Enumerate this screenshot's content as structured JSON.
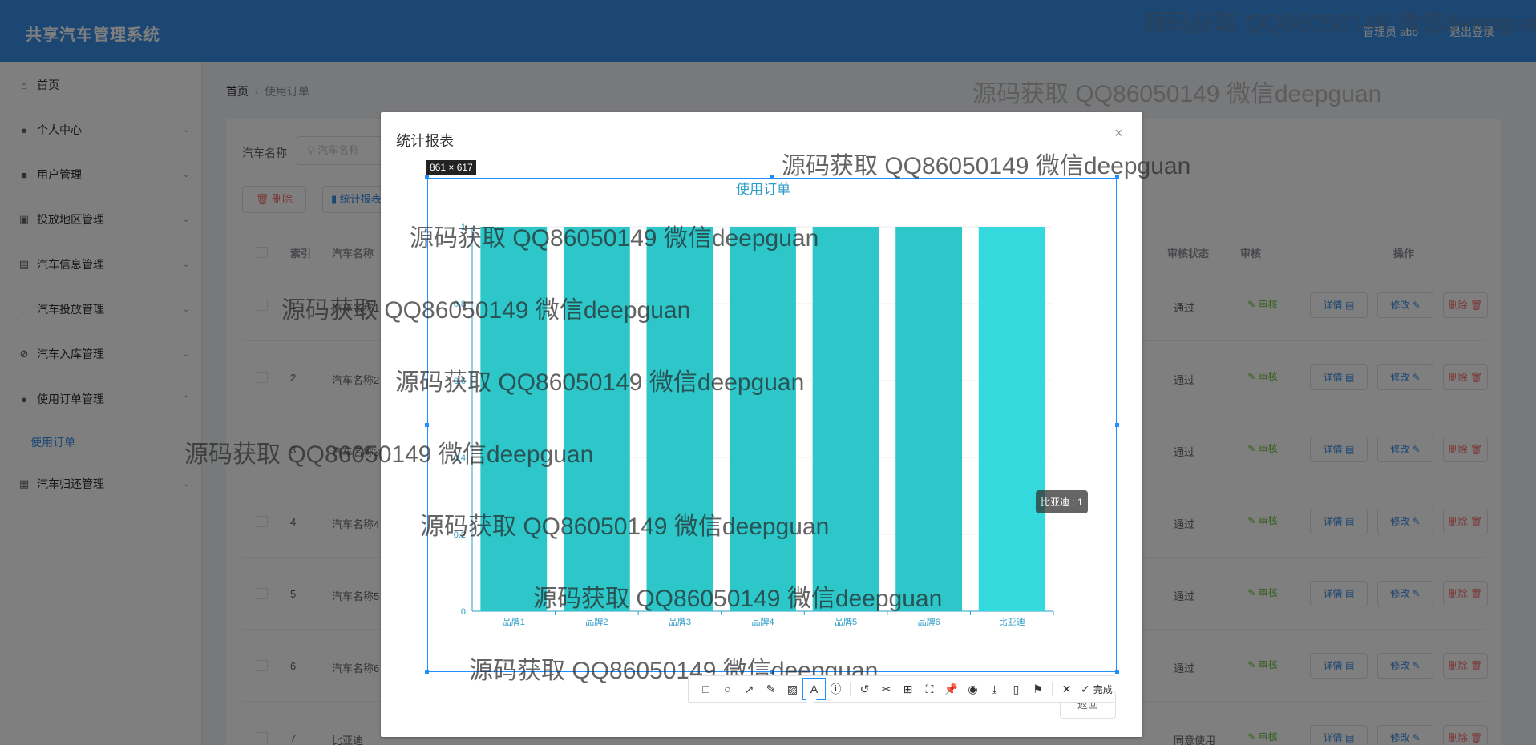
{
  "header": {
    "title": "共享汽车管理系统",
    "user": "管理员 abo",
    "logout": "退出登录"
  },
  "sidebar": {
    "items": [
      {
        "label": "首页",
        "icon": "home-icon",
        "chevron": false
      },
      {
        "label": "个人中心",
        "icon": "user-icon",
        "chevron": true
      },
      {
        "label": "用户管理",
        "icon": "users-icon",
        "chevron": true
      },
      {
        "label": "投放地区管理",
        "icon": "location-icon",
        "chevron": true
      },
      {
        "label": "汽车信息管理",
        "icon": "car-icon",
        "chevron": true
      },
      {
        "label": "汽车投放管理",
        "icon": "circle-icon",
        "chevron": true
      },
      {
        "label": "汽车入库管理",
        "icon": "store-icon",
        "chevron": true
      },
      {
        "label": "使用订单管理",
        "icon": "order-icon",
        "chevron": true
      },
      {
        "label": "汽车归还管理",
        "icon": "grid-icon",
        "chevron": true
      }
    ],
    "subitem": "使用订单"
  },
  "breadcrumb": {
    "home": "首页",
    "current": "使用订单"
  },
  "search": {
    "label": "汽车名称",
    "placeholder": "汽车名称"
  },
  "toolbar": {
    "delete": "删除",
    "stats": "统计报表"
  },
  "table": {
    "headers": {
      "index": "索引",
      "name": "汽车名称",
      "status": "审核状态",
      "review": "审核",
      "ops": "操作"
    },
    "rows": [
      {
        "index": "1",
        "name": "汽车名称1",
        "status": "通过"
      },
      {
        "index": "2",
        "name": "汽车名称2",
        "status": "通过"
      },
      {
        "index": "3",
        "name": "汽车名称3",
        "status": "通过"
      },
      {
        "index": "4",
        "name": "汽车名称4",
        "status": "通过"
      },
      {
        "index": "5",
        "name": "汽车名称5",
        "status": "通过"
      },
      {
        "index": "6",
        "name": "汽车名称6",
        "status": "通过"
      },
      {
        "index": "7",
        "name": "比亚迪",
        "status": "同意使用"
      }
    ],
    "actions": {
      "review": "审核",
      "detail": "详情",
      "edit": "修改",
      "delete": "删除"
    }
  },
  "dialog": {
    "title": "统计报表",
    "close": "×",
    "return": "返回"
  },
  "selection": {
    "size_label": "861 × 617"
  },
  "capture_toolbar": {
    "done": "完成"
  },
  "tooltip": "比亚迪 : 1",
  "watermark": "源码获取 QQ86050149 微信deepguan",
  "colors": {
    "header": "#3a8ee6",
    "bar": "#2ec7c9",
    "bar_highlight": "#33d9dc"
  },
  "chart_data": {
    "type": "bar",
    "title": "使用订单",
    "categories": [
      "品牌1",
      "品牌2",
      "品牌3",
      "品牌4",
      "品牌5",
      "品牌6",
      "比亚迪"
    ],
    "values": [
      1,
      1,
      1,
      1,
      1,
      1,
      1
    ],
    "ylim": [
      0,
      1
    ],
    "yticks": [
      "0",
      "0.2",
      "0.4",
      "0.6",
      "0.8",
      "1"
    ],
    "grid": true
  }
}
